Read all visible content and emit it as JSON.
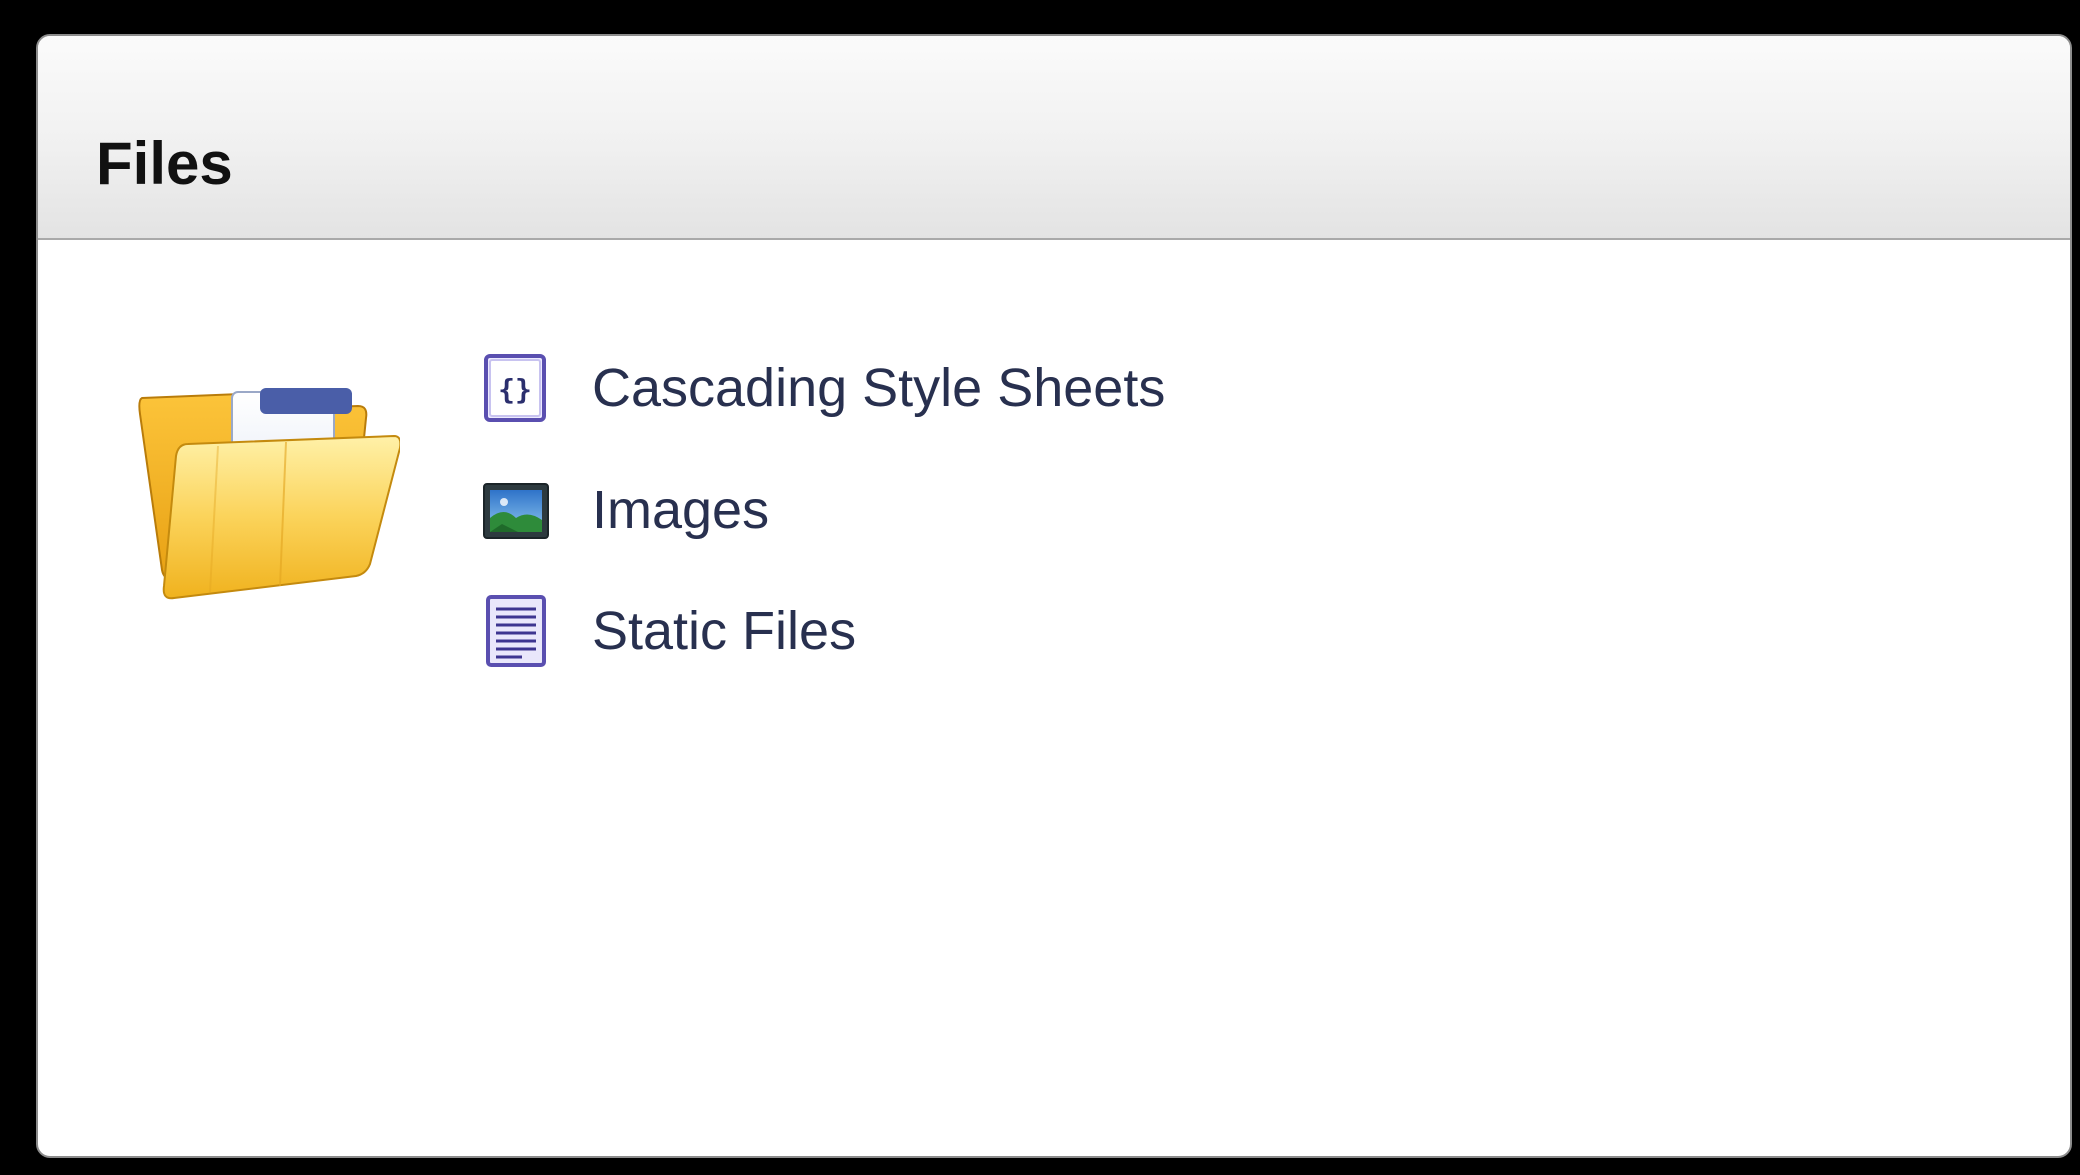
{
  "panel": {
    "title": "Files",
    "folder_icon": "folder-icon",
    "items": [
      {
        "label": "Cascading Style Sheets",
        "icon": "css-file-icon"
      },
      {
        "label": "Images",
        "icon": "image-file-icon"
      },
      {
        "label": "Static Files",
        "icon": "text-file-icon"
      }
    ]
  },
  "colors": {
    "background": "#000000",
    "panel": "#ffffff",
    "title_text": "#111111",
    "link_text": "#28304f",
    "folder": "#f6b624",
    "icon_purple": "#5a4fb0"
  }
}
